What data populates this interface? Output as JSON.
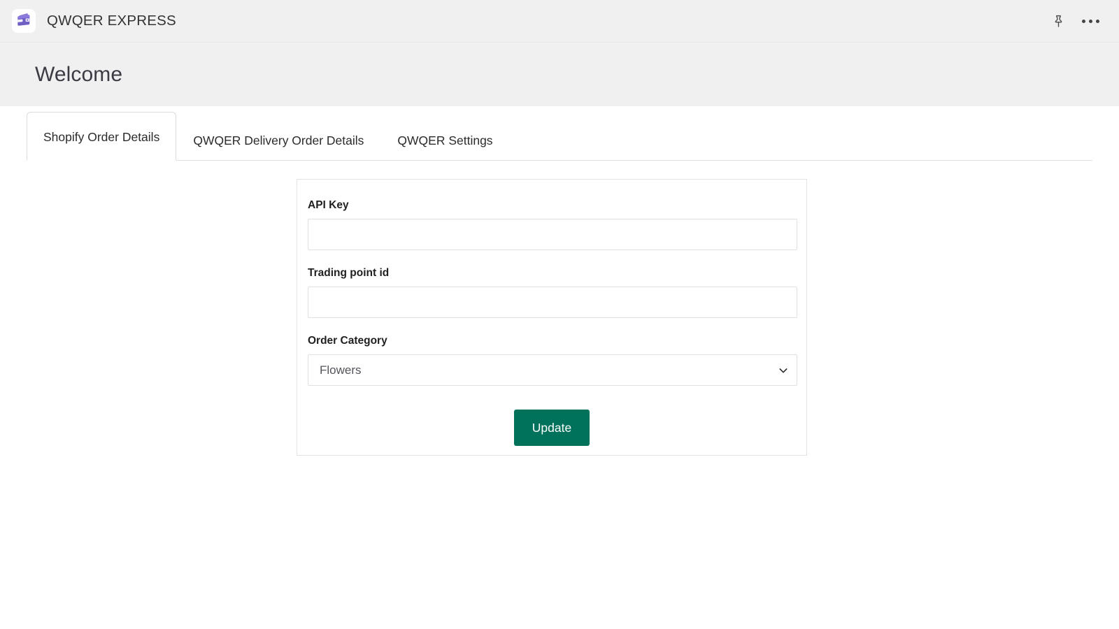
{
  "topbar": {
    "app_title": "QWQER EXPRESS",
    "logo_icon": "wallet-icon",
    "logo_color": "#7b68c9",
    "pin_icon": "pin-icon",
    "more_icon": "ellipsis-icon"
  },
  "page": {
    "heading": "Welcome"
  },
  "tabs": [
    {
      "label": "Shopify Order Details",
      "active": true
    },
    {
      "label": "QWQER Delivery Order Details",
      "active": false
    },
    {
      "label": "QWQER Settings",
      "active": false
    }
  ],
  "form": {
    "api_key": {
      "label": "API Key",
      "value": "",
      "placeholder": ""
    },
    "trading_point_id": {
      "label": "Trading point id",
      "value": "",
      "placeholder": ""
    },
    "order_category": {
      "label": "Order Category",
      "selected": "Flowers",
      "chevron_icon": "chevron-down-icon"
    },
    "submit": {
      "label": "Update",
      "color": "#00715a"
    }
  }
}
